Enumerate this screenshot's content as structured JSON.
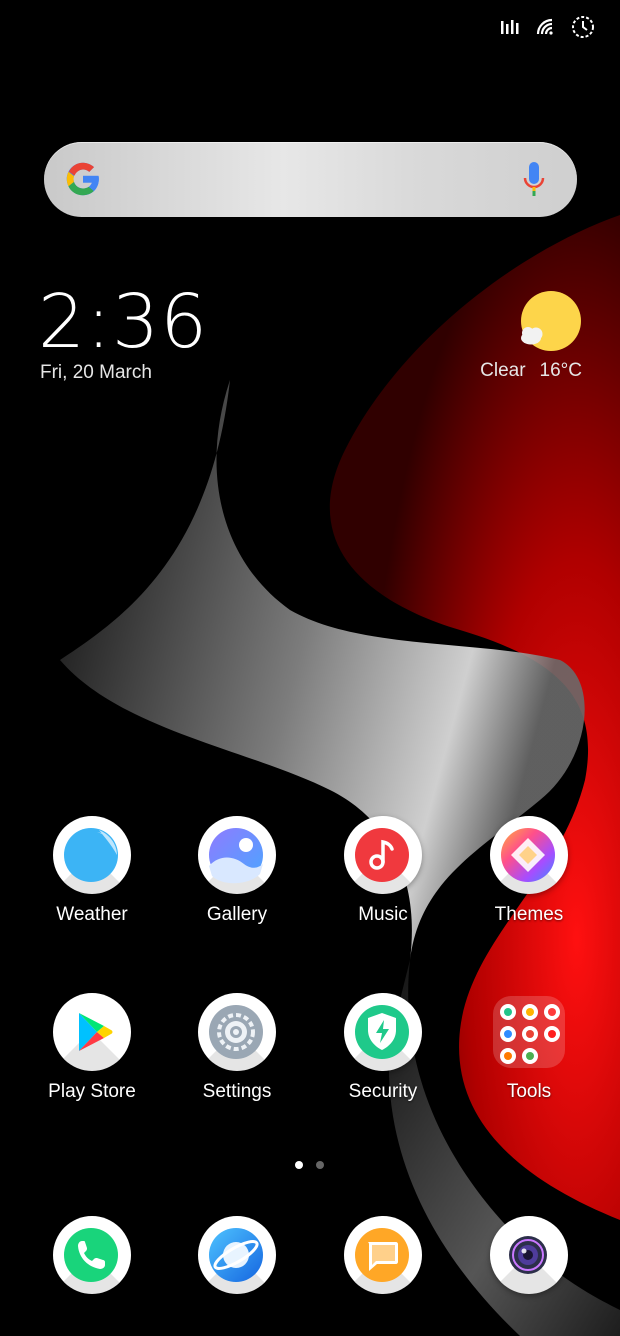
{
  "status_bar": {
    "icons": [
      "signal-icon",
      "wifi-icon",
      "alarm-clock-icon"
    ]
  },
  "search": {
    "provider_icon": "google-g-icon",
    "voice_icon": "mic-icon"
  },
  "clock": {
    "time": "2:36",
    "date": "Fri, 20 March"
  },
  "weather": {
    "icon": "sun-cloud-icon",
    "condition": "Clear",
    "temperature": "16°C"
  },
  "apps_row1": [
    {
      "label": "Weather",
      "icon": "weather-icon"
    },
    {
      "label": "Gallery",
      "icon": "gallery-icon"
    },
    {
      "label": "Music",
      "icon": "music-icon"
    },
    {
      "label": "Themes",
      "icon": "themes-icon"
    }
  ],
  "apps_row2": [
    {
      "label": "Play Store",
      "icon": "play-store-icon"
    },
    {
      "label": "Settings",
      "icon": "settings-icon"
    },
    {
      "label": "Security",
      "icon": "security-icon"
    },
    {
      "label": "Tools",
      "icon": "tools-folder-icon"
    }
  ],
  "page_indicator": {
    "current": 1,
    "total": 2
  },
  "dock": [
    {
      "icon": "phone-icon"
    },
    {
      "icon": "browser-icon"
    },
    {
      "icon": "messages-icon"
    },
    {
      "icon": "camera-icon"
    }
  ],
  "colors": {
    "accent_red": "#e00000",
    "music_red": "#f0393e",
    "security_green": "#1fc98a",
    "phone_green": "#19d47b",
    "weather_blue": "#3cb4f5"
  }
}
